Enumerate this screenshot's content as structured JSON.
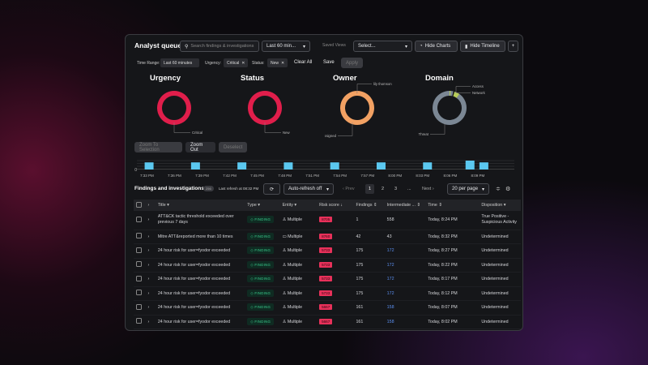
{
  "header": {
    "title": "Analyst queue",
    "search_placeholder": "Search findings & investigations",
    "time_select": "Last 60 min...",
    "saved_views_label": "Saved Views",
    "saved_views_select": "Select...",
    "hide_charts": "Hide Charts",
    "hide_timeline": "Hide Timeline",
    "add": "+"
  },
  "filters": {
    "time_range_label": "Time Range:",
    "time_range_value": "Last 60 minutes",
    "urgency_label": "Urgency:",
    "urgency_value": "Critical",
    "status_label": "Status:",
    "status_value": "New",
    "clear_all": "Clear All",
    "save": "Save",
    "apply": "Apply"
  },
  "charts": [
    {
      "title": "Urgency",
      "slices": [
        {
          "label": "Critical",
          "value": 100,
          "color": "#e01e4b"
        }
      ]
    },
    {
      "title": "Status",
      "slices": [
        {
          "label": "New",
          "value": 100,
          "color": "#e01e4b"
        }
      ]
    },
    {
      "title": "Owner",
      "slices": [
        {
          "label": "unassigned",
          "value": 99.5,
          "color": "#f2a163"
        },
        {
          "label": "lily thomson",
          "value": 0.5,
          "color": "#f2a163"
        }
      ]
    },
    {
      "title": "Domain",
      "slices": [
        {
          "label": "Threat",
          "value": 94,
          "color": "#7b8794"
        },
        {
          "label": "Network",
          "value": 5,
          "color": "#b7cc5a"
        },
        {
          "label": "Access",
          "value": 1,
          "color": "#b7cc5a"
        }
      ]
    }
  ],
  "timeline": {
    "zoom_to_selection": "Zoom To Selection",
    "zoom_out": "Zoom Out",
    "deselect": "Deselect",
    "y_tick": "0",
    "ticks": [
      "7:33 PM",
      "7:36 PM",
      "7:39 PM",
      "7:42 PM",
      "7:45 PM",
      "7:48 PM",
      "7:51 PM",
      "7:54 PM",
      "7:57 PM",
      "8:00 PM",
      "8:03 PM",
      "8:06 PM",
      "8:09 PM"
    ],
    "bar_color": "#5bc8f0",
    "bars": [
      {
        "pos": 0.25,
        "v": 4
      },
      {
        "pos": 1.92,
        "v": 4
      },
      {
        "pos": 3.59,
        "v": 4
      },
      {
        "pos": 5.26,
        "v": 4
      },
      {
        "pos": 6.93,
        "v": 4
      },
      {
        "pos": 8.6,
        "v": 4
      },
      {
        "pos": 10.27,
        "v": 4
      },
      {
        "pos": 11.8,
        "v": 5
      },
      {
        "pos": 12.3,
        "v": 4
      }
    ]
  },
  "list": {
    "title": "Findings and investigations",
    "count": "256",
    "last_refresh": "Last refresh at 08:32 PM",
    "auto_refresh": "Auto-refresh off",
    "prev": "Prev",
    "pages": [
      "1",
      "2",
      "3",
      "..."
    ],
    "next": "Next",
    "per_page": "20 per page",
    "columns": [
      "Title",
      "Type",
      "Entity",
      "Risk score",
      "Findings",
      "Intermediate ...",
      "Time",
      "Disposition"
    ],
    "rows": [
      {
        "title": "ATT&CK tactic threshold exceeded over previous 7 days",
        "type": "FINDING",
        "entity": "Multiple",
        "entity_icon": "user",
        "risk": "8705",
        "findings": "1",
        "intermediate": "558",
        "inter_blue": false,
        "time": "Today, 8:24 PM",
        "disposition": "True Positive - Suspicious Activity"
      },
      {
        "title": "Mitre ATT&reported more than 10 times",
        "type": "FINDING",
        "entity": "Multiple",
        "entity_icon": "monitor",
        "risk": "8760",
        "findings": "42",
        "intermediate": "43",
        "inter_blue": false,
        "time": "Today, 8:32 PM",
        "disposition": "Undetermined"
      },
      {
        "title": "24 hour risk for user=fyodor exceeded",
        "type": "FINDING",
        "entity": "Multiple",
        "entity_icon": "user",
        "risk": "5733",
        "findings": "175",
        "intermediate": "172",
        "inter_blue": true,
        "time": "Today, 8:27 PM",
        "disposition": "Undetermined"
      },
      {
        "title": "24 hour risk for user=fyodor exceeded",
        "type": "FINDING",
        "entity": "Multiple",
        "entity_icon": "user",
        "risk": "5733",
        "findings": "175",
        "intermediate": "172",
        "inter_blue": true,
        "time": "Today, 8:22 PM",
        "disposition": "Undetermined"
      },
      {
        "title": "24 hour risk for user=fyodor exceeded",
        "type": "FINDING",
        "entity": "Multiple",
        "entity_icon": "user",
        "risk": "5733",
        "findings": "175",
        "intermediate": "172",
        "inter_blue": true,
        "time": "Today, 8:17 PM",
        "disposition": "Undetermined"
      },
      {
        "title": "24 hour risk for user=fyodor exceeded",
        "type": "FINDING",
        "entity": "Multiple",
        "entity_icon": "user",
        "risk": "5733",
        "findings": "175",
        "intermediate": "172",
        "inter_blue": true,
        "time": "Today, 8:12 PM",
        "disposition": "Undetermined"
      },
      {
        "title": "24 hour risk for user=fyodor exceeded",
        "type": "FINDING",
        "entity": "Multiple",
        "entity_icon": "user",
        "risk": "5667",
        "findings": "161",
        "intermediate": "158",
        "inter_blue": true,
        "time": "Today, 8:07 PM",
        "disposition": "Undetermined"
      },
      {
        "title": "24 hour risk for user=fyodor exceeded",
        "type": "FINDING",
        "entity": "Multiple",
        "entity_icon": "user",
        "risk": "5667",
        "findings": "161",
        "intermediate": "158",
        "inter_blue": true,
        "time": "Today, 8:02 PM",
        "disposition": "Undetermined"
      }
    ]
  }
}
